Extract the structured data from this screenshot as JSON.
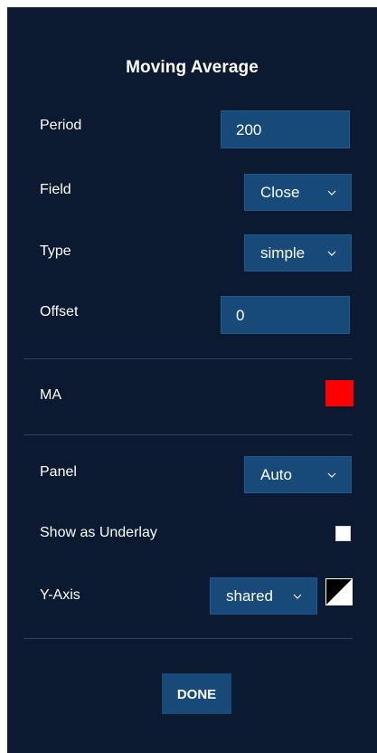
{
  "dialog": {
    "title": "Moving Average"
  },
  "fields": {
    "period": {
      "label": "Period",
      "value": "200"
    },
    "field": {
      "label": "Field",
      "value": "Close"
    },
    "type": {
      "label": "Type",
      "value": "simple"
    },
    "offset": {
      "label": "Offset",
      "value": "0"
    }
  },
  "outputs": {
    "ma": {
      "label": "MA",
      "color": "#ff0000"
    }
  },
  "options": {
    "panel": {
      "label": "Panel",
      "value": "Auto"
    },
    "underlay": {
      "label": "Show as Underlay",
      "checked": false
    },
    "yaxis": {
      "label": "Y-Axis",
      "value": "shared"
    }
  },
  "actions": {
    "done_label": "DONE"
  },
  "colors": {
    "background": "#0b1a30",
    "control": "#174a78",
    "text": "#ffffff"
  },
  "icons": {
    "chevron": "chevron-down-icon",
    "yaxis_color": "diagonal-color-swatch-icon"
  }
}
